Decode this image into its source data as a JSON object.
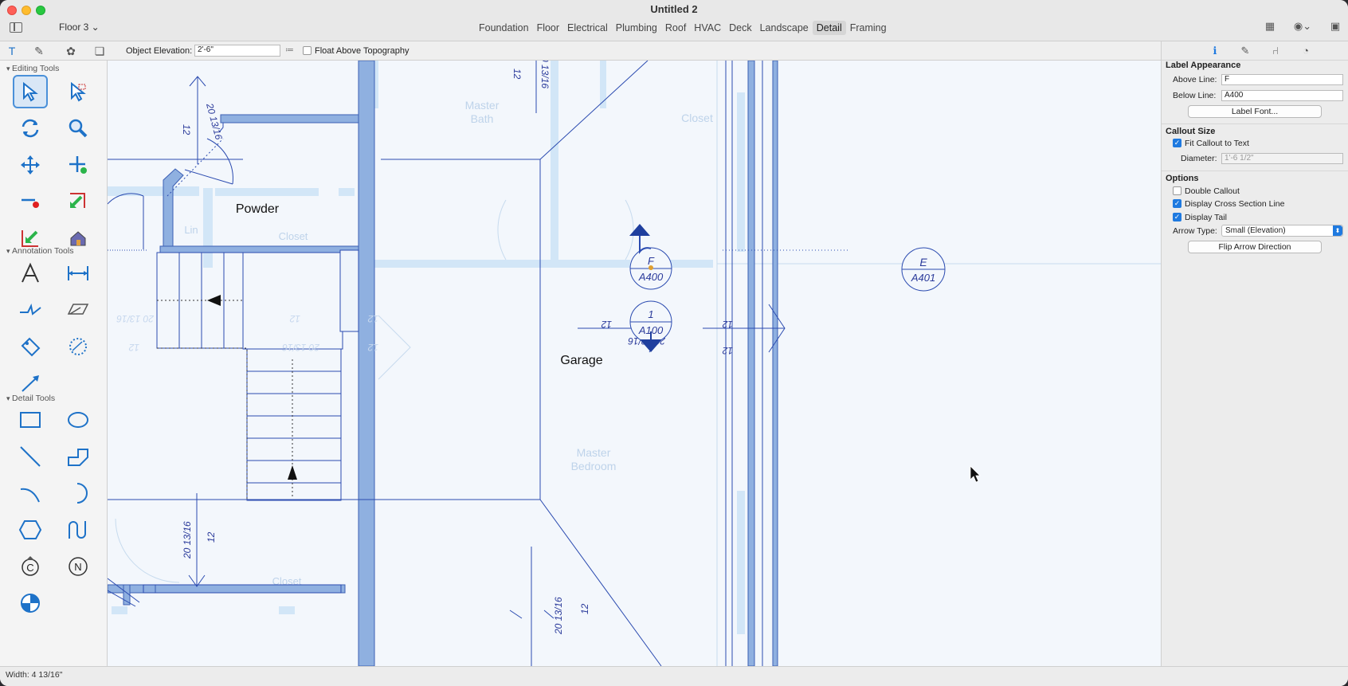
{
  "window": {
    "title": "Untitled 2"
  },
  "toolbar": {
    "floor_label": "Floor 3 ⌄",
    "tabs": [
      {
        "label": "Foundation"
      },
      {
        "label": "Floor"
      },
      {
        "label": "Electrical"
      },
      {
        "label": "Plumbing"
      },
      {
        "label": "Roof"
      },
      {
        "label": "HVAC"
      },
      {
        "label": "Deck"
      },
      {
        "label": "Landscape"
      },
      {
        "label": "Detail"
      },
      {
        "label": "Framing"
      }
    ],
    "active_tab": "Detail"
  },
  "options_bar": {
    "elevation_label": "Object Elevation:",
    "elevation_value": "2'-6\"",
    "float_label": "Float Above Topography"
  },
  "palette": {
    "editing_title": "Editing Tools",
    "annotation_title": "Annotation Tools",
    "detail_title": "Detail Tools",
    "callout_c": "C",
    "north_n": "N"
  },
  "plan": {
    "rooms": {
      "powder": "Powder",
      "garage": "Garage",
      "master_bath": "Master\nBath",
      "closet": "Closet",
      "lin": "Lin",
      "master_bedroom": "Master\nBedroom"
    },
    "callouts": {
      "c1_top": "F",
      "c1_bottom": "A400",
      "c2_top": "1",
      "c2_bottom": "A100",
      "c3_top": "E",
      "c3_bottom": "A401"
    },
    "dims": {
      "d12": "12",
      "d20": "20 13/16",
      "d0": "0 13/16",
      "d20_1316": "20 13/16"
    }
  },
  "properties": {
    "label_appearance_title": "Label Appearance",
    "above_line_label": "Above Line:",
    "above_line_value": "F",
    "below_line_label": "Below Line:",
    "below_line_value": "A400",
    "label_font_button": "Label Font...",
    "callout_size_title": "Callout Size",
    "fit_label": "Fit Callout to Text",
    "diameter_label": "Diameter:",
    "diameter_value": "1'-6 1/2\"",
    "options_title": "Options",
    "double_callout_label": "Double Callout",
    "cross_section_label": "Display Cross Section Line",
    "display_tail_label": "Display Tail",
    "arrow_type_label": "Arrow Type:",
    "arrow_type_value": "Small (Elevation)",
    "flip_button": "Flip Arrow Direction"
  },
  "status": {
    "text": "Width: 4 13/16\""
  },
  "colors": {
    "accent": "#1f7ae0",
    "wall": "#8fb0e0",
    "line": "#2b4bb0"
  }
}
